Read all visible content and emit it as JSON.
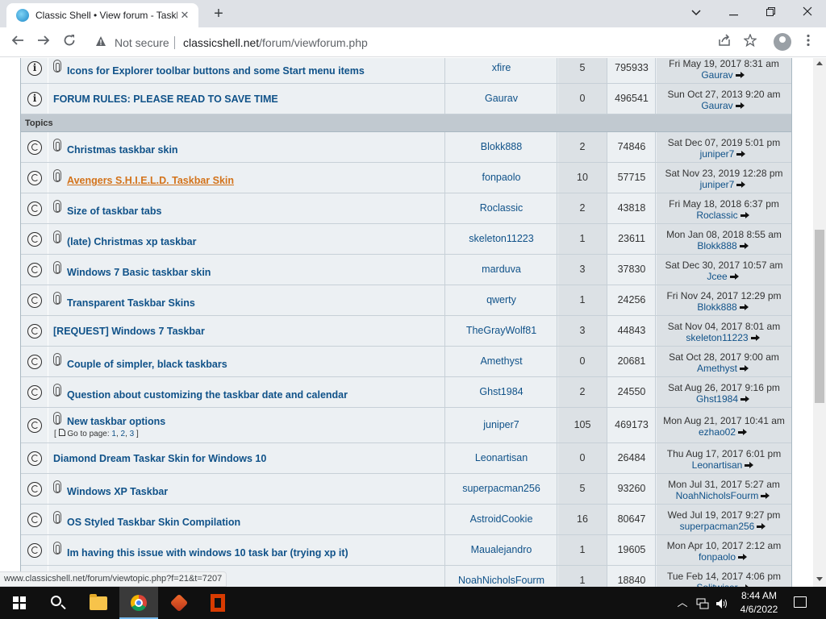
{
  "browser": {
    "tab_title": "Classic Shell • View forum - Taskbar",
    "tab_close": "✕",
    "new_tab": "+",
    "window_controls": {
      "dropdown": "⌄",
      "minimize": "—",
      "maximize": "❐",
      "close": "✕"
    },
    "not_secure": "Not secure",
    "url_host": "classicshell.net",
    "url_path": "/forum/viewforum.php",
    "status_url": "www.classicshell.net/forum/viewtopic.php?f=21&t=7207"
  },
  "forum": {
    "announcements": [
      {
        "icon": "info",
        "attachment": true,
        "title": "Icons for Explorer toolbar buttons and some Start menu items",
        "author": "xfire",
        "replies": "5",
        "views": "795933",
        "last_date": "Fri May 19, 2017 8:31 am",
        "last_user": "Gaurav"
      },
      {
        "icon": "info-lock",
        "attachment": false,
        "title": "FORUM RULES: PLEASE READ TO SAVE TIME",
        "author": "Gaurav",
        "replies": "0",
        "views": "496541",
        "last_date": "Sun Oct 27, 2013 9:20 am",
        "last_user": "Gaurav"
      }
    ],
    "topics_header": "Topics",
    "topics": [
      {
        "attachment": true,
        "title": "Christmas taskbar skin",
        "author": "Blokk888",
        "replies": "2",
        "views": "74846",
        "last_date": "Sat Dec 07, 2019 5:01 pm",
        "last_user": "juniper7"
      },
      {
        "attachment": true,
        "title": "Avengers S.H.I.E.L.D. Taskbar Skin",
        "hover": true,
        "author": "fonpaolo",
        "replies": "10",
        "views": "57715",
        "last_date": "Sat Nov 23, 2019 12:28 pm",
        "last_user": "juniper7"
      },
      {
        "attachment": true,
        "title": "Size of taskbar tabs",
        "author": "Roclassic",
        "replies": "2",
        "views": "43818",
        "last_date": "Fri May 18, 2018 6:37 pm",
        "last_user": "Roclassic"
      },
      {
        "attachment": true,
        "title": "(late) Christmas xp taskbar",
        "author": "skeleton11223",
        "replies": "1",
        "views": "23611",
        "last_date": "Mon Jan 08, 2018 8:55 am",
        "last_user": "Blokk888"
      },
      {
        "attachment": true,
        "title": "Windows 7 Basic taskbar skin",
        "author": "marduva",
        "replies": "3",
        "views": "37830",
        "last_date": "Sat Dec 30, 2017 10:57 am",
        "last_user": "Jcee"
      },
      {
        "attachment": true,
        "title": "Transparent Taskbar Skins",
        "author": "qwerty",
        "replies": "1",
        "views": "24256",
        "last_date": "Fri Nov 24, 2017 12:29 pm",
        "last_user": "Blokk888"
      },
      {
        "attachment": false,
        "title": "[REQUEST] Windows 7 Taskbar",
        "author": "TheGrayWolf81",
        "replies": "3",
        "views": "44843",
        "last_date": "Sat Nov 04, 2017 8:01 am",
        "last_user": "skeleton11223"
      },
      {
        "attachment": true,
        "title": "Couple of simpler, black taskbars",
        "author": "Amethyst",
        "replies": "0",
        "views": "20681",
        "last_date": "Sat Oct 28, 2017 9:00 am",
        "last_user": "Amethyst"
      },
      {
        "attachment": true,
        "title": "Question about customizing the taskbar date and calendar",
        "author": "Ghst1984",
        "replies": "2",
        "views": "24550",
        "last_date": "Sat Aug 26, 2017 9:16 pm",
        "last_user": "Ghst1984"
      },
      {
        "attachment": true,
        "title": "New taskbar options",
        "pagination": {
          "prefix": "[",
          "label": "Go to page:",
          "pages": [
            "1",
            "2",
            "3"
          ],
          "suffix": "]"
        },
        "author": "juniper7",
        "replies": "105",
        "views": "469173",
        "last_date": "Mon Aug 21, 2017 10:41 am",
        "last_user": "ezhao02"
      },
      {
        "attachment": false,
        "title": "Diamond Dream Taskar Skin for Windows 10",
        "author": "Leonartisan",
        "replies": "0",
        "views": "26484",
        "last_date": "Thu Aug 17, 2017 6:01 pm",
        "last_user": "Leonartisan"
      },
      {
        "attachment": true,
        "title": "Windows XP Taskbar",
        "author": "superpacman256",
        "replies": "5",
        "views": "93260",
        "last_date": "Mon Jul 31, 2017 5:27 am",
        "last_user": "NoahNicholsFourm"
      },
      {
        "attachment": true,
        "title": "OS Styled Taskbar Skin Compilation",
        "author": "AstroidCookie",
        "replies": "16",
        "views": "80647",
        "last_date": "Wed Jul 19, 2017 9:27 pm",
        "last_user": "superpacman256"
      },
      {
        "attachment": true,
        "title": "Im having this issue with windows 10 task bar (trying xp it)",
        "author": "Maualejandro",
        "replies": "1",
        "views": "19605",
        "last_date": "Mon Apr 10, 2017 2:12 am",
        "last_user": "fonpaolo"
      },
      {
        "attachment": false,
        "title": "",
        "author": "NoahNicholsFourm",
        "replies": "1",
        "views": "18840",
        "last_date": "Tue Feb 14, 2017 4:06 pm",
        "last_user": "Solitwiser"
      }
    ]
  },
  "taskbar": {
    "time": "8:44 AM",
    "date": "4/6/2022",
    "tray_chevron": "︿"
  },
  "colors": {
    "link": "#105289",
    "hover_link": "#d3731b",
    "row_bg": "#ecf0f3",
    "row_alt": "#dce1e5"
  }
}
